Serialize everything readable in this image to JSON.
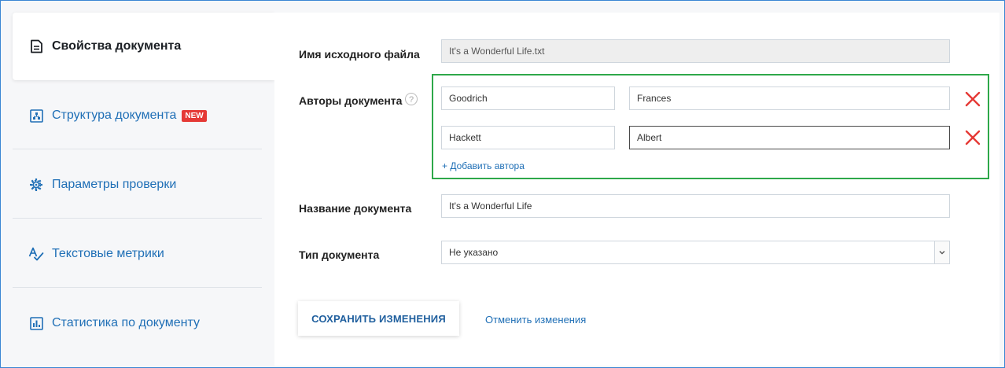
{
  "sidebar": {
    "items": [
      {
        "label": "Свойства документа",
        "icon": "document-icon",
        "active": true
      },
      {
        "label": "Структура документа",
        "icon": "structure-icon",
        "badge": "NEW"
      },
      {
        "label": "Параметры проверки",
        "icon": "gear-icon"
      },
      {
        "label": "Текстовые метрики",
        "icon": "text-metrics-icon"
      },
      {
        "label": "Статистика по документу",
        "icon": "chart-icon"
      }
    ]
  },
  "form": {
    "source_file": {
      "label": "Имя исходного файла",
      "value": "It's a Wonderful Life.txt"
    },
    "authors": {
      "label": "Авторы документа",
      "help": "?",
      "list": [
        {
          "last": "Goodrich",
          "first": "Frances"
        },
        {
          "last": "Hackett",
          "first": "Albert"
        }
      ],
      "add_label": "+ Добавить автора"
    },
    "title": {
      "label": "Название документа",
      "value": "It's a Wonderful Life"
    },
    "type": {
      "label": "Тип документа",
      "value": "Не указано"
    }
  },
  "actions": {
    "save": "СОХРАНИТЬ ИЗМЕНЕНИЯ",
    "cancel": "Отменить изменения"
  },
  "colors": {
    "accent": "#1f6fb6",
    "highlight_border": "#2ea84a",
    "remove": "#e53935",
    "badge": "#e53935"
  }
}
